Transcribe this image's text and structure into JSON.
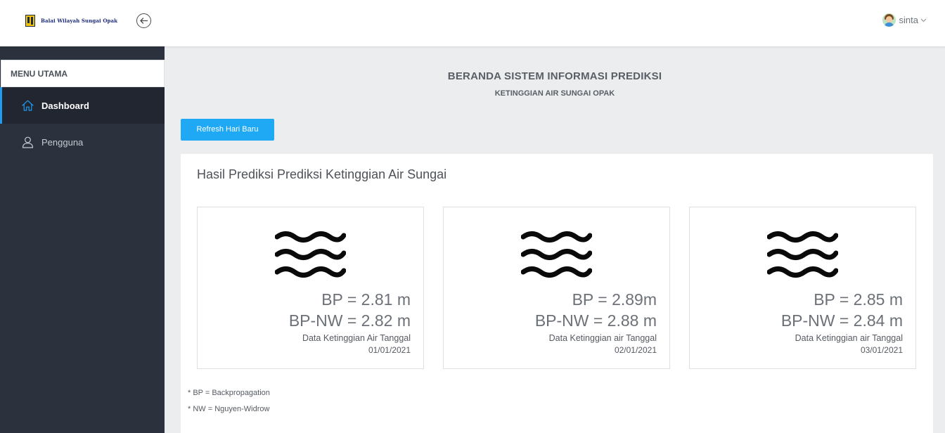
{
  "header": {
    "brand_text": "Balai Wilayah Sungai Opak",
    "user_name": "sinta"
  },
  "sidebar": {
    "menu_title": "MENU UTAMA",
    "items": [
      {
        "label": "Dashboard",
        "icon": "home-icon",
        "active": true
      },
      {
        "label": "Pengguna",
        "icon": "user-icon",
        "active": false
      }
    ]
  },
  "main": {
    "title": "BERANDA SISTEM INFORMASI PREDIKSI",
    "subtitle": "KETINGGIAN AIR SUNGAI OPAK",
    "refresh_label": "Refresh Hari Baru",
    "panel_title": "Hasil Prediksi Prediksi Ketinggian Air Sungai",
    "cards": [
      {
        "bp": "BP = 2.81 m",
        "bp_nw": "BP-NW = 2.82 m",
        "caption": "Data Ketinggian Air Tanggal",
        "date": "01/01/2021",
        "icon": "water-icon"
      },
      {
        "bp": "BP = 2.89m",
        "bp_nw": "BP-NW = 2.88 m",
        "caption": "Data Ketinggian air Tanggal",
        "date": "02/01/2021",
        "icon": "water-icon"
      },
      {
        "bp": "BP = 2.85 m",
        "bp_nw": "BP-NW = 2.84 m",
        "caption": "Data Ketinggian air Tanggal",
        "date": "03/01/2021",
        "icon": "water-icon"
      }
    ],
    "notes": [
      "* BP = Backpropagation",
      "* NW = Nguyen-Widrow"
    ]
  },
  "colors": {
    "accent": "#1fa8f3",
    "sidebar_bg": "#2b323e",
    "sidebar_active_bg": "#212630",
    "page_bg": "#ebedef"
  }
}
